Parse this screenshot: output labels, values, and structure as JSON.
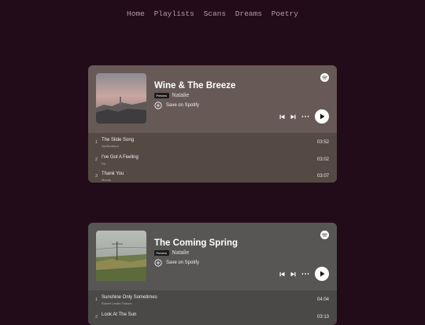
{
  "nav": [
    "Home",
    "Playlists",
    "Scans",
    "Dreams",
    "Poetry"
  ],
  "players": [
    {
      "title": "Wine & The Breeze",
      "badge": "Preview",
      "artist": "Natalie",
      "save_label": "Save on Spotify",
      "tracks": [
        {
          "num": "1",
          "name": "The Slide Song",
          "artist": "Spiritualized",
          "duration": "03:52"
        },
        {
          "num": "2",
          "name": "I've Got A Feeling",
          "artist": "Ivy",
          "duration": "03:02"
        },
        {
          "num": "3",
          "name": "Thank You",
          "artist": "Moods",
          "duration": "03:07"
        }
      ]
    },
    {
      "title": "The Coming Spring",
      "badge": "Preview",
      "artist": "Natalie",
      "save_label": "Save on Spotify",
      "tracks": [
        {
          "num": "1",
          "name": "Sunshine Only Sometimes",
          "artist": "Robert Lester Folsom",
          "duration": "04:04"
        },
        {
          "num": "2",
          "name": "Look At The Sun",
          "artist": "",
          "duration": "03:13"
        }
      ]
    }
  ],
  "colors": {
    "background": "#230c19",
    "card1": "#675a56",
    "card2": "#575655",
    "nav_text": "#b39aa6"
  },
  "icons": {
    "logo": "spotify-logo-icon",
    "save": "plus-circle-icon",
    "prev": "skip-back-icon",
    "next": "skip-forward-icon",
    "more": "more-dots-icon",
    "play": "play-icon"
  }
}
